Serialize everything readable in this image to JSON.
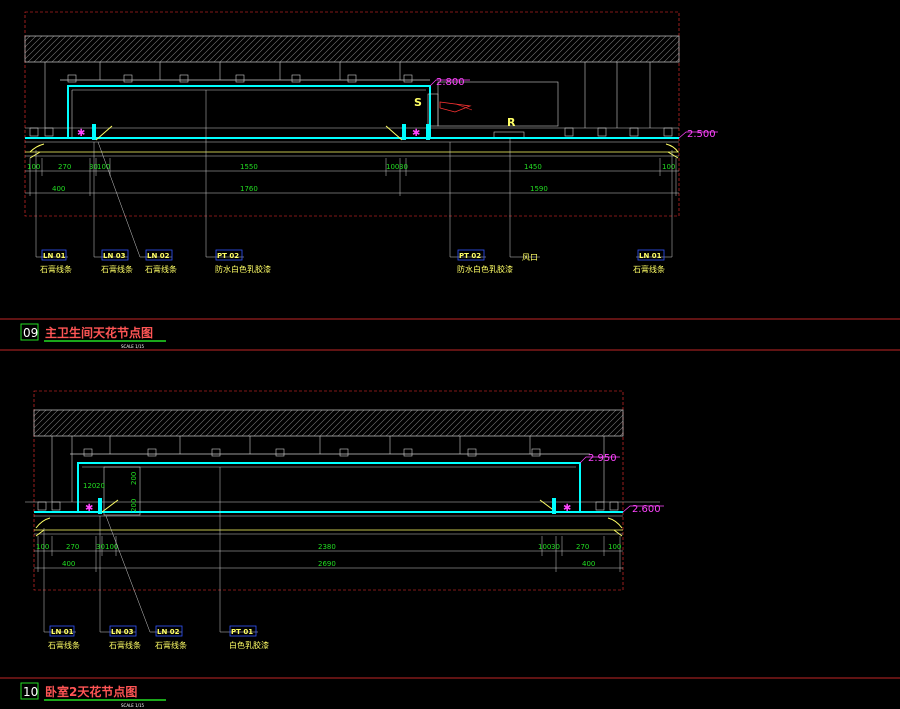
{
  "drawing1": {
    "number": "09",
    "title": "主卫生间天花节点图",
    "scale": "SCALE 1/15",
    "elev_high": "2.800",
    "elev_low": "2.500",
    "markers": {
      "s": "S",
      "r": "R"
    },
    "dims_row1": [
      "100",
      "270",
      "30",
      "100",
      "1550",
      "100",
      "30",
      "1450",
      "100"
    ],
    "dims_row2": [
      "400",
      "1760",
      "1590"
    ],
    "tags": [
      {
        "code": "LN 01",
        "name": "石膏线条"
      },
      {
        "code": "LN 03",
        "name": "石膏线条"
      },
      {
        "code": "LN 02",
        "name": "石膏线条"
      },
      {
        "code": "PT 02",
        "name": "防水白色乳胶漆"
      },
      {
        "code": "PT 02",
        "name": "防水白色乳胶漆"
      },
      {
        "code": "",
        "name": "风口"
      },
      {
        "code": "LN 01",
        "name": "石膏线条"
      }
    ]
  },
  "drawing2": {
    "number": "10",
    "title": "卧室2天花节点图",
    "scale": "SCALE 1/15",
    "elev_high": "2.950",
    "elev_low": "2.600",
    "dims_inner": [
      "120",
      "20",
      "200",
      "200"
    ],
    "dims_row1": [
      "100",
      "270",
      "30",
      "100",
      "2380",
      "100",
      "30",
      "270",
      "100"
    ],
    "dims_row2": [
      "400",
      "2690",
      "400"
    ],
    "tags": [
      {
        "code": "LN 01",
        "name": "石膏线条"
      },
      {
        "code": "LN 03",
        "name": "石膏线条"
      },
      {
        "code": "LN 02",
        "name": "石膏线条"
      },
      {
        "code": "PT 01",
        "name": "白色乳胶漆"
      }
    ]
  },
  "colors": {
    "background": "#000000",
    "cyan": "#00ffff",
    "red": "#ff3333",
    "yellow": "#ffff66",
    "magenta": "#ff44ff",
    "green": "#22dd22"
  }
}
